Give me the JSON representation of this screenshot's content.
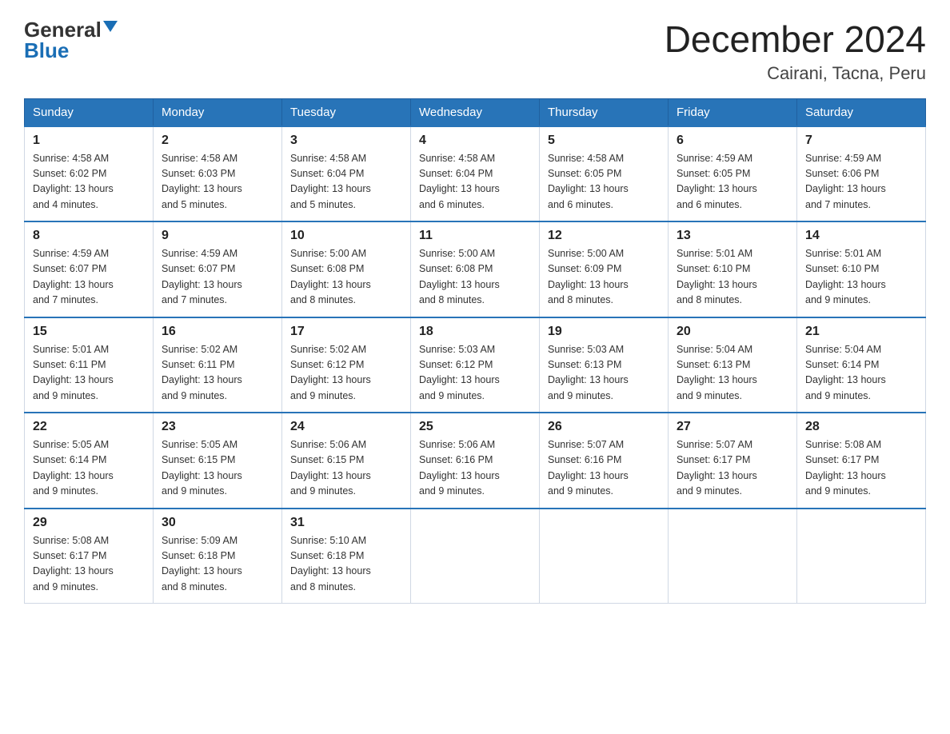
{
  "logo": {
    "general": "General",
    "blue": "Blue"
  },
  "title": "December 2024",
  "subtitle": "Cairani, Tacna, Peru",
  "days_of_week": [
    "Sunday",
    "Monday",
    "Tuesday",
    "Wednesday",
    "Thursday",
    "Friday",
    "Saturday"
  ],
  "weeks": [
    [
      {
        "day": "1",
        "sunrise": "4:58 AM",
        "sunset": "6:02 PM",
        "daylight": "13 hours and 4 minutes."
      },
      {
        "day": "2",
        "sunrise": "4:58 AM",
        "sunset": "6:03 PM",
        "daylight": "13 hours and 5 minutes."
      },
      {
        "day": "3",
        "sunrise": "4:58 AM",
        "sunset": "6:04 PM",
        "daylight": "13 hours and 5 minutes."
      },
      {
        "day": "4",
        "sunrise": "4:58 AM",
        "sunset": "6:04 PM",
        "daylight": "13 hours and 6 minutes."
      },
      {
        "day": "5",
        "sunrise": "4:58 AM",
        "sunset": "6:05 PM",
        "daylight": "13 hours and 6 minutes."
      },
      {
        "day": "6",
        "sunrise": "4:59 AM",
        "sunset": "6:05 PM",
        "daylight": "13 hours and 6 minutes."
      },
      {
        "day": "7",
        "sunrise": "4:59 AM",
        "sunset": "6:06 PM",
        "daylight": "13 hours and 7 minutes."
      }
    ],
    [
      {
        "day": "8",
        "sunrise": "4:59 AM",
        "sunset": "6:07 PM",
        "daylight": "13 hours and 7 minutes."
      },
      {
        "day": "9",
        "sunrise": "4:59 AM",
        "sunset": "6:07 PM",
        "daylight": "13 hours and 7 minutes."
      },
      {
        "day": "10",
        "sunrise": "5:00 AM",
        "sunset": "6:08 PM",
        "daylight": "13 hours and 8 minutes."
      },
      {
        "day": "11",
        "sunrise": "5:00 AM",
        "sunset": "6:08 PM",
        "daylight": "13 hours and 8 minutes."
      },
      {
        "day": "12",
        "sunrise": "5:00 AM",
        "sunset": "6:09 PM",
        "daylight": "13 hours and 8 minutes."
      },
      {
        "day": "13",
        "sunrise": "5:01 AM",
        "sunset": "6:10 PM",
        "daylight": "13 hours and 8 minutes."
      },
      {
        "day": "14",
        "sunrise": "5:01 AM",
        "sunset": "6:10 PM",
        "daylight": "13 hours and 9 minutes."
      }
    ],
    [
      {
        "day": "15",
        "sunrise": "5:01 AM",
        "sunset": "6:11 PM",
        "daylight": "13 hours and 9 minutes."
      },
      {
        "day": "16",
        "sunrise": "5:02 AM",
        "sunset": "6:11 PM",
        "daylight": "13 hours and 9 minutes."
      },
      {
        "day": "17",
        "sunrise": "5:02 AM",
        "sunset": "6:12 PM",
        "daylight": "13 hours and 9 minutes."
      },
      {
        "day": "18",
        "sunrise": "5:03 AM",
        "sunset": "6:12 PM",
        "daylight": "13 hours and 9 minutes."
      },
      {
        "day": "19",
        "sunrise": "5:03 AM",
        "sunset": "6:13 PM",
        "daylight": "13 hours and 9 minutes."
      },
      {
        "day": "20",
        "sunrise": "5:04 AM",
        "sunset": "6:13 PM",
        "daylight": "13 hours and 9 minutes."
      },
      {
        "day": "21",
        "sunrise": "5:04 AM",
        "sunset": "6:14 PM",
        "daylight": "13 hours and 9 minutes."
      }
    ],
    [
      {
        "day": "22",
        "sunrise": "5:05 AM",
        "sunset": "6:14 PM",
        "daylight": "13 hours and 9 minutes."
      },
      {
        "day": "23",
        "sunrise": "5:05 AM",
        "sunset": "6:15 PM",
        "daylight": "13 hours and 9 minutes."
      },
      {
        "day": "24",
        "sunrise": "5:06 AM",
        "sunset": "6:15 PM",
        "daylight": "13 hours and 9 minutes."
      },
      {
        "day": "25",
        "sunrise": "5:06 AM",
        "sunset": "6:16 PM",
        "daylight": "13 hours and 9 minutes."
      },
      {
        "day": "26",
        "sunrise": "5:07 AM",
        "sunset": "6:16 PM",
        "daylight": "13 hours and 9 minutes."
      },
      {
        "day": "27",
        "sunrise": "5:07 AM",
        "sunset": "6:17 PM",
        "daylight": "13 hours and 9 minutes."
      },
      {
        "day": "28",
        "sunrise": "5:08 AM",
        "sunset": "6:17 PM",
        "daylight": "13 hours and 9 minutes."
      }
    ],
    [
      {
        "day": "29",
        "sunrise": "5:08 AM",
        "sunset": "6:17 PM",
        "daylight": "13 hours and 9 minutes."
      },
      {
        "day": "30",
        "sunrise": "5:09 AM",
        "sunset": "6:18 PM",
        "daylight": "13 hours and 8 minutes."
      },
      {
        "day": "31",
        "sunrise": "5:10 AM",
        "sunset": "6:18 PM",
        "daylight": "13 hours and 8 minutes."
      },
      null,
      null,
      null,
      null
    ]
  ],
  "labels": {
    "sunrise": "Sunrise:",
    "sunset": "Sunset:",
    "daylight": "Daylight:"
  }
}
